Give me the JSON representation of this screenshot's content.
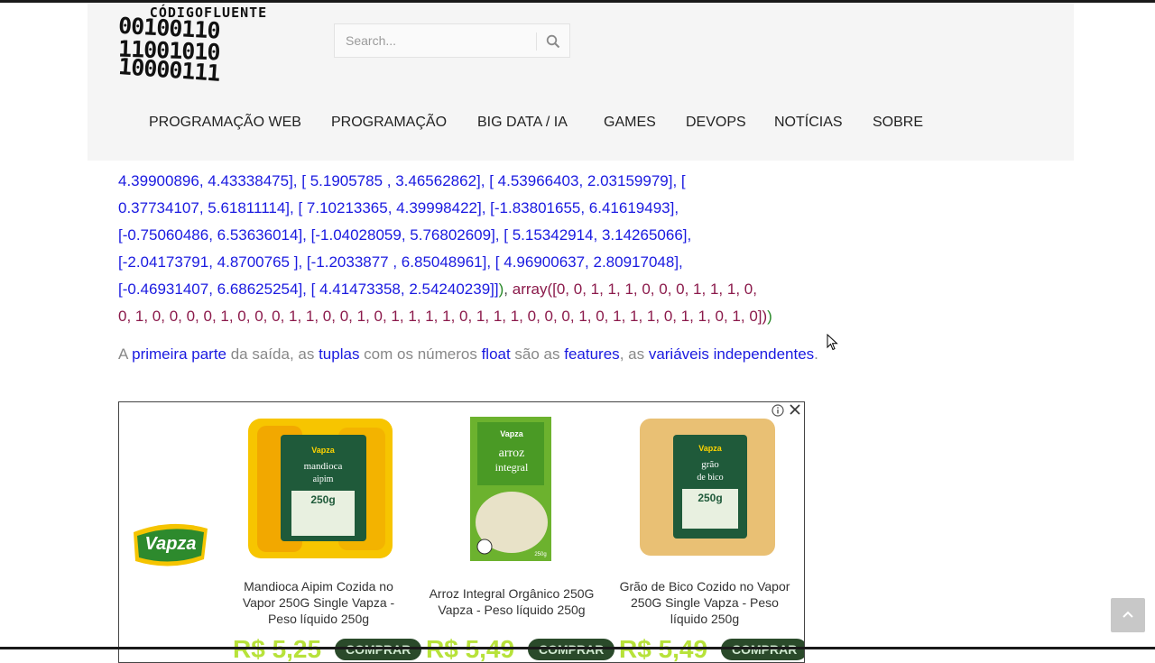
{
  "header": {
    "logo_title": "CÓDIGOFLUENTE",
    "logo_lines": [
      "00100110",
      "11001010",
      "10000111"
    ],
    "search_placeholder": "Search...",
    "nav": [
      "PROGRAMAÇÃO WEB",
      "PROGRAMAÇÃO",
      "BIG DATA / IA",
      "GAMES",
      "DEVOPS",
      "NOTÍCIAS",
      "SOBRE"
    ]
  },
  "content": {
    "code_lines": [
      "4.39900896, 4.43338475], [ 5.1905785 , 3.46562862], [ 4.53966403, 2.03159979], [",
      "0.37734107, 5.61811114], [ 7.10213365, 4.39998422], [-1.83801655, 6.41619493],",
      "[-0.75060486, 6.53636014], [-1.04028059, 5.76802609], [ 5.15342914, 3.14265066],",
      "[-2.04173791, 4.8700765 ], [-1.2033877 , 6.85048961], [ 4.96900637, 2.80917048],"
    ],
    "code_line5_blue": "[-0.46931407, 6.68625254], [ 4.41473358, 2.54240239]]",
    "code_line5_paren": ")",
    "code_line5_comma": ", ",
    "code_line5_array": "array([0, 0, 1, 1, 1, 0, 0, 0, 1, 1, 1, 0,",
    "code_line6_array": "0, 1, 0, 0, 0, 0, 1, 0, 0, 0, 1, 1, 0, 0, 1, 0, 1, 1, 1, 1, 0, 1, 1, 1, 0, 0, 0, 1, 0, 1, 1, 1, 0, 1, 1, 0, 1, 0])",
    "code_line6_paren": ")",
    "para": {
      "t1": "A ",
      "k1": "primeira parte",
      "t2": " da saída, as ",
      "k2": "tuplas",
      "t3": " com os números ",
      "k3": "float",
      "t4": " são as ",
      "k4": "features",
      "t5": ", as ",
      "k5": "variáveis independentes",
      "t6": "."
    }
  },
  "ad": {
    "brand": "Vapza",
    "products": [
      {
        "name": "Mandioca Aipim Cozida no Vapor 250G Single Vapza - Peso líquido 250g",
        "pkg_line1": "mandioca",
        "pkg_line2": "aipim",
        "pkg_weight": "250g",
        "price": "R$ 5,25",
        "buy": "COMPRAR"
      },
      {
        "name": "Arroz Integral Orgânico 250G Vapza - Peso líquido 250g",
        "pkg_line1": "arroz",
        "pkg_line2": "integral",
        "pkg_weight": "250g",
        "price": "R$ 5,49",
        "buy": "COMPRAR"
      },
      {
        "name": "Grão de Bico Cozido no Vapor 250G Single Vapza - Peso líquido 250g",
        "pkg_line1": "grão",
        "pkg_line2": "de bico",
        "pkg_weight": "250g",
        "price": "R$ 5,49",
        "buy": "COMPRAR"
      }
    ]
  },
  "colors": {
    "accent_blue": "#1a1ae0",
    "code_array": "#8b1a4b",
    "paren_green": "#2a8a2a",
    "header_bg": "#f5f5f5"
  }
}
